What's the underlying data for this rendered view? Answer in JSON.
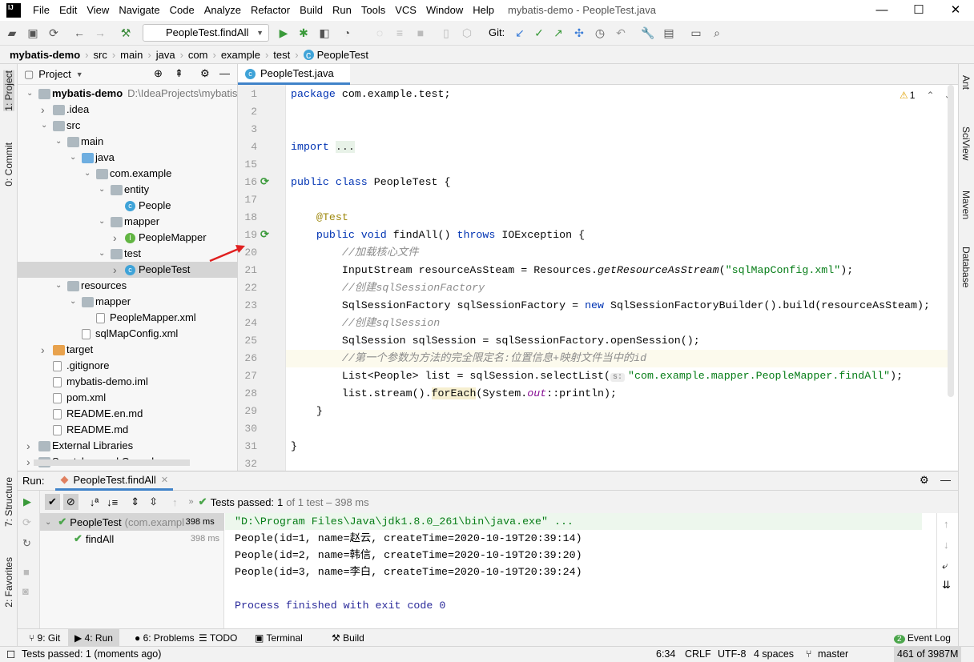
{
  "window": {
    "title": "mybatis-demo - PeopleTest.java",
    "app_logo": "IJ"
  },
  "menu": [
    "File",
    "Edit",
    "View",
    "Navigate",
    "Code",
    "Analyze",
    "Refactor",
    "Build",
    "Run",
    "Tools",
    "VCS",
    "Window",
    "Help"
  ],
  "toolbar": {
    "run_config": "PeopleTest.findAll",
    "git_label": "Git:"
  },
  "breadcrumb": [
    "mybatis-demo",
    "src",
    "main",
    "java",
    "com",
    "example",
    "test",
    "PeopleTest"
  ],
  "left_stripe": [
    "1: Project",
    "0: Commit",
    "7: Structure",
    "2: Favorites"
  ],
  "right_stripe": [
    "Ant",
    "SciView",
    "Maven",
    "Database"
  ],
  "project": {
    "title": "Project",
    "items": [
      {
        "level": 0,
        "arrow": "open",
        "icon": "folder",
        "label": "mybatis-demo",
        "bold": true,
        "hint": "D:\\IdeaProjects\\mybatis"
      },
      {
        "level": 1,
        "arrow": "closed",
        "icon": "folder",
        "label": ".idea"
      },
      {
        "level": 1,
        "arrow": "open",
        "icon": "folder",
        "label": "src"
      },
      {
        "level": 2,
        "arrow": "open",
        "icon": "folder",
        "label": "main"
      },
      {
        "level": 3,
        "arrow": "open",
        "icon": "bluef",
        "label": "java"
      },
      {
        "level": 4,
        "arrow": "open",
        "icon": "folder",
        "label": "com.example"
      },
      {
        "level": 5,
        "arrow": "open",
        "icon": "folder",
        "label": "entity"
      },
      {
        "level": 6,
        "arrow": "",
        "icon": "cls",
        "label": "People"
      },
      {
        "level": 5,
        "arrow": "open",
        "icon": "folder",
        "label": "mapper"
      },
      {
        "level": 6,
        "arrow": "closed",
        "icon": "intf",
        "label": "PeopleMapper"
      },
      {
        "level": 5,
        "arrow": "open",
        "icon": "folder",
        "label": "test"
      },
      {
        "level": 6,
        "arrow": "closed",
        "icon": "cls",
        "label": "PeopleTest",
        "selected": true
      },
      {
        "level": 2,
        "arrow": "open",
        "icon": "folder",
        "label": "resources"
      },
      {
        "level": 3,
        "arrow": "open",
        "icon": "folder",
        "label": "mapper"
      },
      {
        "level": 4,
        "arrow": "",
        "icon": "file",
        "label": "PeopleMapper.xml"
      },
      {
        "level": 3,
        "arrow": "",
        "icon": "file",
        "label": "sqlMapConfig.xml"
      },
      {
        "level": 1,
        "arrow": "closed",
        "icon": "orangef",
        "label": "target"
      },
      {
        "level": 1,
        "arrow": "",
        "icon": "file",
        "label": ".gitignore"
      },
      {
        "level": 1,
        "arrow": "",
        "icon": "file",
        "label": "mybatis-demo.iml"
      },
      {
        "level": 1,
        "arrow": "",
        "icon": "file",
        "label": "pom.xml"
      },
      {
        "level": 1,
        "arrow": "",
        "icon": "file",
        "label": "README.en.md"
      },
      {
        "level": 1,
        "arrow": "",
        "icon": "file",
        "label": "README.md"
      },
      {
        "level": 0,
        "arrow": "closed",
        "icon": "folder",
        "label": "External Libraries"
      },
      {
        "level": 0,
        "arrow": "closed",
        "icon": "folder",
        "label": "Scratches and Consoles"
      }
    ]
  },
  "editor": {
    "tab": "PeopleTest.java",
    "warnings": "1",
    "lines": [
      {
        "n": 1,
        "segs": [
          [
            "kw",
            "package "
          ],
          [
            "",
            "com.example.test;"
          ]
        ]
      },
      {
        "n": 2,
        "segs": []
      },
      {
        "n": 3,
        "segs": []
      },
      {
        "n": 4,
        "segs": [
          [
            "kw",
            "import "
          ],
          [
            "fold",
            "..."
          ]
        ]
      },
      {
        "n": 15,
        "segs": []
      },
      {
        "n": 16,
        "segs": [
          [
            "kw",
            "public class "
          ],
          [
            "",
            "PeopleTest {"
          ]
        ]
      },
      {
        "n": 17,
        "segs": []
      },
      {
        "n": 18,
        "segs": [
          [
            "",
            "    "
          ],
          [
            "ann",
            "@Test"
          ]
        ]
      },
      {
        "n": 19,
        "segs": [
          [
            "",
            "    "
          ],
          [
            "kw",
            "public void "
          ],
          [
            "",
            "findAll() "
          ],
          [
            "kw",
            "throws "
          ],
          [
            "",
            "IOException {"
          ]
        ]
      },
      {
        "n": 20,
        "segs": [
          [
            "",
            "        "
          ],
          [
            "cmt",
            "//加载核心文件"
          ]
        ]
      },
      {
        "n": 21,
        "segs": [
          [
            "",
            "        InputStream resourceAsSteam = Resources."
          ],
          [
            "it",
            "getResourceAsStream"
          ],
          [
            "",
            "("
          ],
          [
            "str",
            "\"sqlMapConfig.xml\""
          ],
          [
            "",
            ");"
          ]
        ]
      },
      {
        "n": 22,
        "segs": [
          [
            "",
            "        "
          ],
          [
            "cmt",
            "//创建sqlSessionFactory"
          ]
        ]
      },
      {
        "n": 23,
        "segs": [
          [
            "",
            "        SqlSessionFactory sqlSessionFactory = "
          ],
          [
            "kw",
            "new "
          ],
          [
            "",
            "SqlSessionFactoryBuilder().build(resourceAsSteam);"
          ]
        ]
      },
      {
        "n": 24,
        "segs": [
          [
            "",
            "        "
          ],
          [
            "cmt",
            "//创建sqlSession"
          ]
        ]
      },
      {
        "n": 25,
        "segs": [
          [
            "",
            "        SqlSession sqlSession = sqlSessionFactory.openSession();"
          ]
        ]
      },
      {
        "n": 26,
        "segs": [
          [
            "",
            "        "
          ],
          [
            "cmt",
            "//第一个参数为方法的完全限定名:位置信息+映射文件当中的id"
          ]
        ],
        "current": true
      },
      {
        "n": 27,
        "segs": [
          [
            "",
            "        List<People> list = sqlSession.selectList("
          ],
          [
            "hintbox",
            "s:"
          ],
          [
            "str",
            "\"com.example.mapper.PeopleMapper.findAll\""
          ],
          [
            "",
            ");"
          ]
        ]
      },
      {
        "n": 28,
        "segs": [
          [
            "",
            "        list.stream()."
          ],
          [
            "hlw",
            "forEach"
          ],
          [
            "",
            "(System."
          ],
          [
            "fld",
            "out"
          ],
          [
            "",
            "::println);"
          ]
        ]
      },
      {
        "n": 29,
        "segs": [
          [
            "",
            "    }"
          ]
        ]
      },
      {
        "n": 30,
        "segs": []
      },
      {
        "n": 31,
        "segs": [
          [
            "",
            "}"
          ]
        ]
      },
      {
        "n": 32,
        "segs": []
      }
    ]
  },
  "run": {
    "label": "Run:",
    "tab": "PeopleTest.findAll",
    "status_prefix": "Tests passed:",
    "status_count": "1",
    "status_rest": "of 1 test – 398 ms",
    "tree": [
      {
        "label": "PeopleTest",
        "hint": "(com.example",
        "time": "398 ms"
      },
      {
        "label": "findAll",
        "time": "398 ms"
      }
    ],
    "console": [
      "\"D:\\Program Files\\Java\\jdk1.8.0_261\\bin\\java.exe\" ...",
      "People(id=1, name=赵云, createTime=2020-10-19T20:39:14)",
      "People(id=2, name=韩信, createTime=2020-10-19T20:39:20)",
      "People(id=3, name=李白, createTime=2020-10-19T20:39:24)",
      "",
      "Process finished with exit code 0"
    ]
  },
  "bottom_tabs": [
    "9: Git",
    "4: Run",
    "6: Problems",
    "TODO",
    "Terminal",
    "Build"
  ],
  "event_log": {
    "count": "2",
    "label": "Event Log"
  },
  "status": {
    "message": "Tests passed: 1 (moments ago)",
    "position": "6:34",
    "line_sep": "CRLF",
    "encoding": "UTF-8",
    "indent": "4 spaces",
    "branch": "master",
    "memory": "461 of 3987M"
  },
  "colors": {
    "accent": "#4083c9",
    "keyword": "#0033b3",
    "string": "#067d17",
    "comment": "#8c8c8c",
    "annotation": "#9e880d",
    "pass": "#4ca64c"
  }
}
